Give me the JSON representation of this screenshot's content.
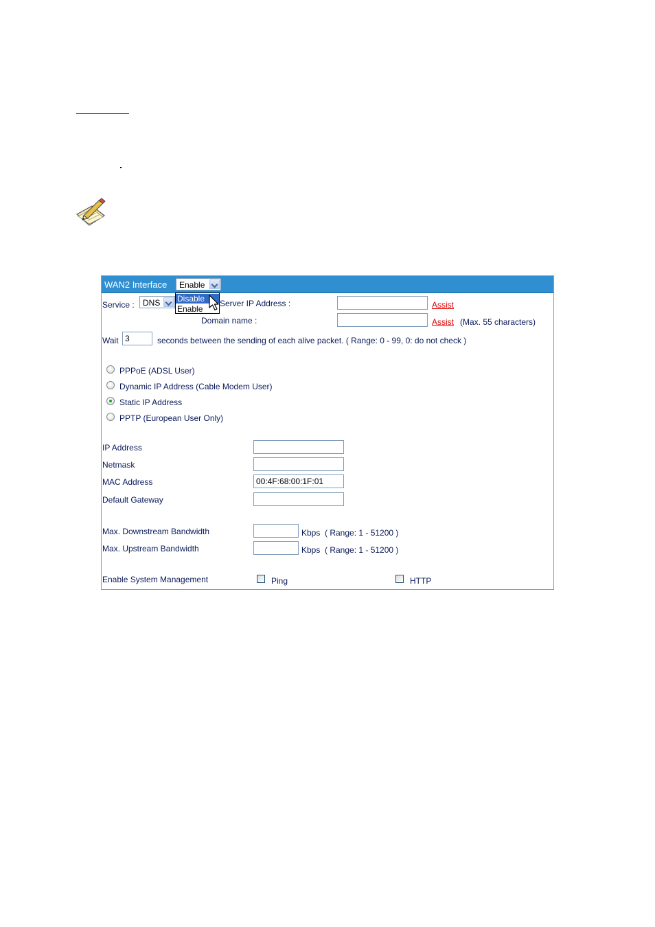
{
  "panel": {
    "title": "WAN2 Interface",
    "interface_select": {
      "value": "Enable",
      "options": [
        "Disable",
        "Enable"
      ],
      "highlighted": "Disable"
    }
  },
  "service": {
    "label": "Service :",
    "value": "DNS",
    "server_ip_label": "Server IP Address :",
    "server_ip_value": "",
    "domain_label": "Domain name :",
    "domain_value": "",
    "assist_label": "Assist",
    "domain_note": "(Max. 55 characters)"
  },
  "alive": {
    "prefix": "Wait",
    "value": "3",
    "suffix": "seconds between the sending of each alive packet. ( Range: 0 - 99, 0: do not check )"
  },
  "connection_types": [
    {
      "label": "PPPoE (ADSL User)",
      "selected": false
    },
    {
      "label": "Dynamic IP Address (Cable Modem User)",
      "selected": false
    },
    {
      "label": "Static IP Address",
      "selected": true
    },
    {
      "label": "PPTP (European User Only)",
      "selected": false
    }
  ],
  "fields": [
    {
      "label": "IP Address",
      "value": ""
    },
    {
      "label": "Netmask",
      "value": ""
    },
    {
      "label": "MAC Address",
      "value": "00:4F:68:00:1F:01"
    },
    {
      "label": "Default Gateway",
      "value": ""
    }
  ],
  "bandwidth": [
    {
      "label": "Max. Downstream Bandwidth",
      "value": "",
      "unit": "Kbps",
      "range": "( Range: 1 - 51200 )"
    },
    {
      "label": "Max. Upstream Bandwidth",
      "value": "",
      "unit": "Kbps",
      "range": "( Range: 1 - 51200 )"
    }
  ],
  "management": {
    "label": "Enable System Management",
    "ping_label": "Ping",
    "ping_checked": false,
    "http_label": "HTTP",
    "http_checked": false
  },
  "colors": {
    "header_bg": "#2f8fd0",
    "assist": "#e00000",
    "label_text": "#0a1a5a",
    "selection": "#316ac5"
  },
  "icons": [
    "note-pencil-icon",
    "mouse-cursor-icon"
  ]
}
